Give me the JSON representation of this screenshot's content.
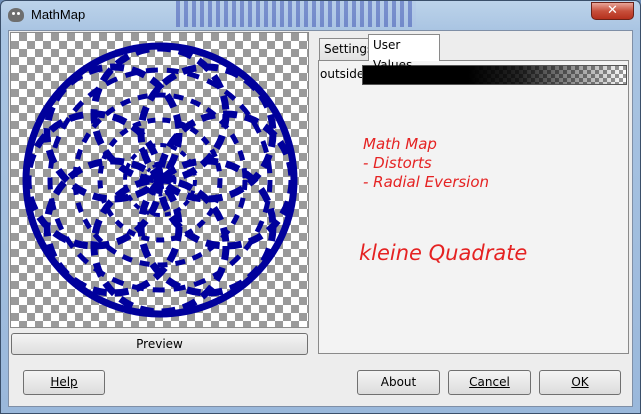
{
  "window": {
    "title": "MathMap",
    "close_glyph": "✕",
    "app_icon": "gimp-icon"
  },
  "preview": {
    "button_label": "Preview",
    "image_colors": {
      "fill": "#00009c",
      "checker": "#9a9a9a"
    }
  },
  "tabs": [
    {
      "label": "Settings",
      "active": false
    },
    {
      "label": "User Values",
      "active": true
    }
  ],
  "user_values": {
    "field_label": "outside"
  },
  "annotations": {
    "line1": "Math Map",
    "line2": "- Distorts",
    "line3": "- Radial Eversion",
    "big": "kleine Quadrate",
    "color": "#e52222"
  },
  "buttons": {
    "help": "Help",
    "about": "About",
    "cancel": "Cancel",
    "ok": "OK"
  }
}
